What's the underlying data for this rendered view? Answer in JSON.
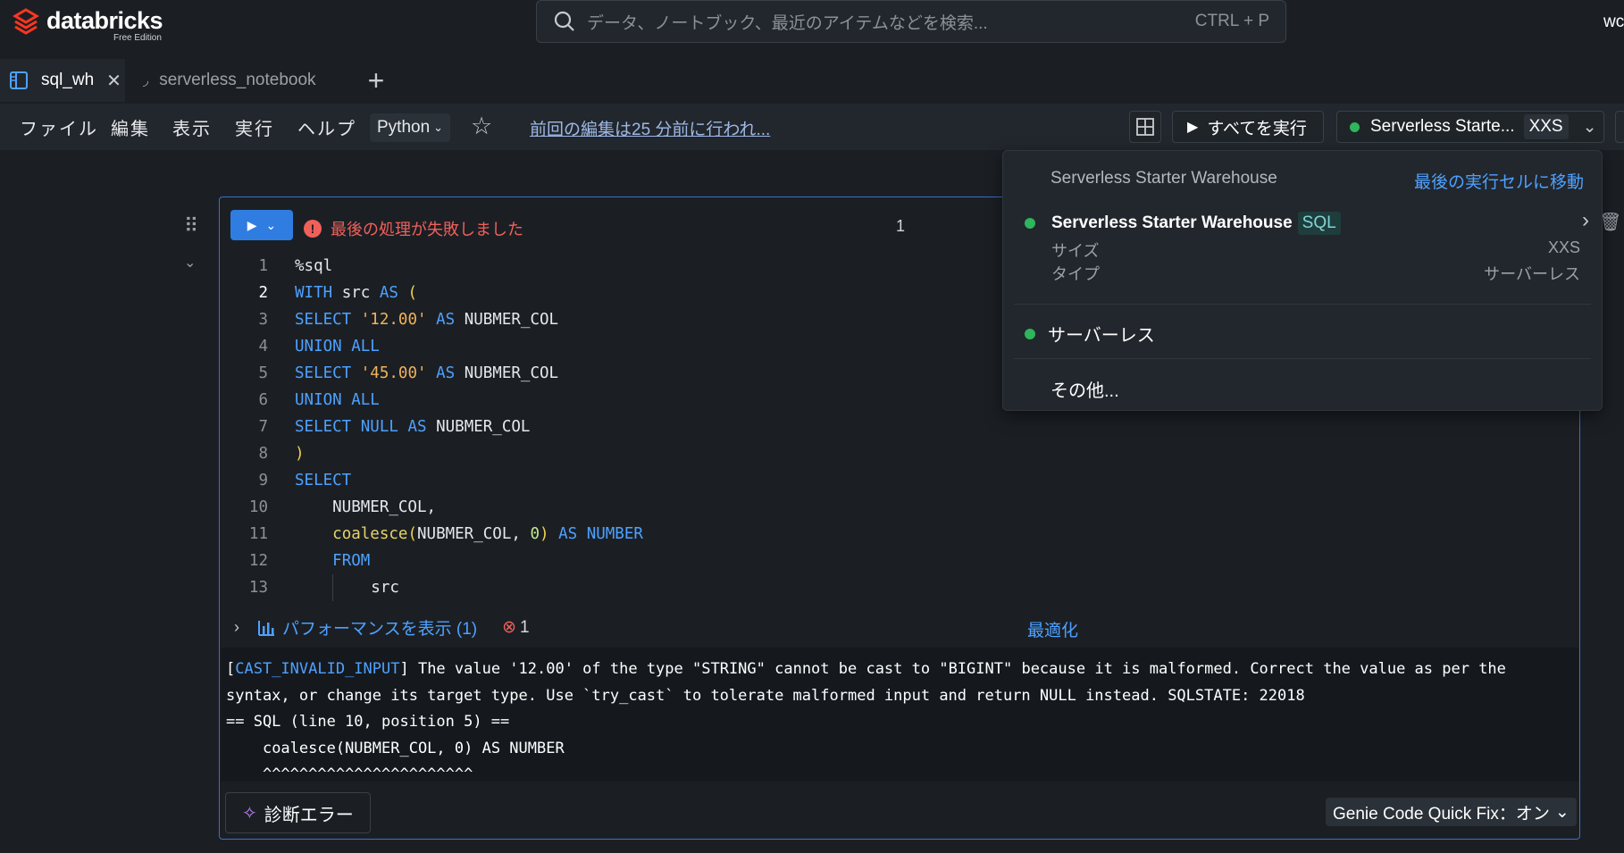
{
  "brand": {
    "name": "databricks",
    "edition": "Free Edition"
  },
  "search": {
    "placeholder": "データ、ノートブック、最近のアイテムなどを検索...",
    "shortcut": "CTRL + P"
  },
  "top_right_text": "wc",
  "tabs": [
    {
      "label": "sql_wh",
      "active": true
    },
    {
      "label": "serverless_notebook",
      "active": false
    }
  ],
  "menu": [
    "ファイル",
    "編集",
    "表示",
    "実行",
    "ヘルプ"
  ],
  "language": "Python",
  "last_edit": "前回の編集は25 分前に行われ...",
  "toolbar": {
    "run_all": "すべてを実行",
    "compute_name": "Serverless Starte...",
    "compute_size": "XXS"
  },
  "cell": {
    "status": "最後の処理が失敗しました",
    "number": "1",
    "code": [
      "%sql",
      "WITH src AS (",
      "SELECT '12.00' AS NUBMER_COL",
      "UNION ALL",
      "SELECT '45.00' AS NUBMER_COL",
      "UNION ALL",
      "SELECT NULL AS NUBMER_COL",
      ")",
      "SELECT",
      "    NUBMER_COL,",
      "    coalesce(NUBMER_COL, 0) AS NUMBER",
      "    FROM",
      "        src"
    ],
    "performance": "パフォーマンスを表示 (1)",
    "error_count": "1",
    "optimize": "最適化",
    "error_class": "CAST_INVALID_INPUT",
    "error_message": "] The value '12.00' of the type \"STRING\" cannot be cast to \"BIGINT\" because it is malformed. Correct the value as per the syntax, or change its target type. Use `try_cast` to tolerate malformed input and return NULL instead. SQLSTATE: 22018",
    "error_sql_pos": "== SQL (line 10, position 5) ==",
    "error_snippet": "    coalesce(NUBMER_COL, 0) AS NUMBER",
    "error_caret": "    ^^^^^^^^^^^^^^^^^^^^^^^",
    "diagnose": "診断エラー",
    "genie": "Genie Code Quick Fix：オン"
  },
  "popover": {
    "header": "Serverless Starter Warehouse",
    "goto_last": "最後の実行セルに移動",
    "warehouse_name": "Serverless Starter Warehouse",
    "warehouse_badge": "SQL",
    "size_label": "サイズ",
    "size_value": "XXS",
    "type_label": "タイプ",
    "type_value": "サーバーレス",
    "serverless": "サーバーレス",
    "other": "その他..."
  },
  "colors": {
    "accent": "#2f7de1",
    "error": "#f0605a",
    "status_green": "#2fb55b"
  }
}
